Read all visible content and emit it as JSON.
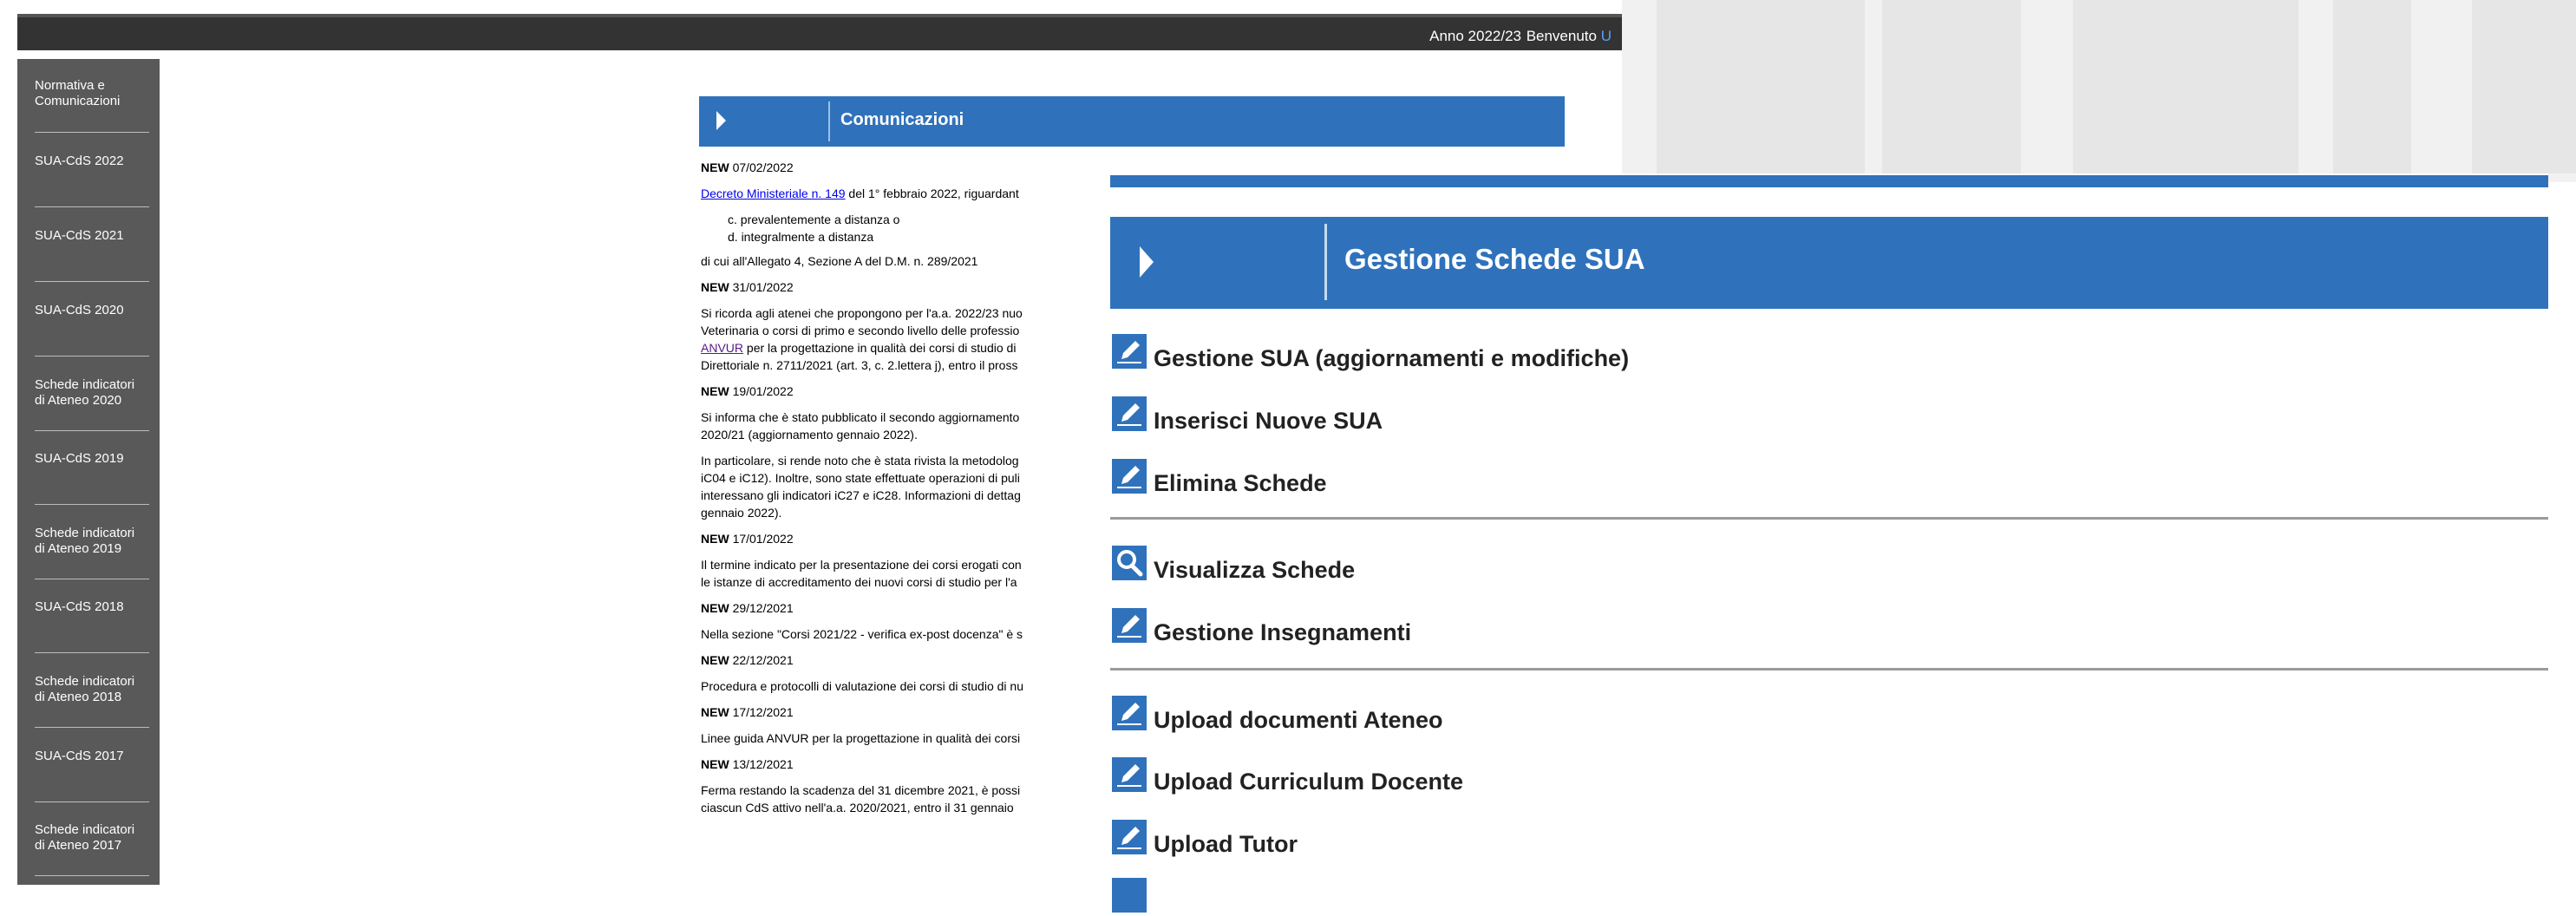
{
  "topbar": {
    "year": "Anno 2022/23",
    "welcome": "Benvenuto",
    "user": "U"
  },
  "sidebar": {
    "items": [
      {
        "line1": "Normativa e",
        "line2": "Comunicazioni"
      },
      {
        "line1": "SUA-CdS 2022",
        "line2": ""
      },
      {
        "line1": "SUA-CdS 2021",
        "line2": ""
      },
      {
        "line1": "SUA-CdS 2020",
        "line2": ""
      },
      {
        "line1": "Schede indicatori",
        "line2": "di Ateneo 2020"
      },
      {
        "line1": "SUA-CdS 2019",
        "line2": ""
      },
      {
        "line1": "Schede indicatori",
        "line2": "di Ateneo 2019"
      },
      {
        "line1": "SUA-CdS 2018",
        "line2": ""
      },
      {
        "line1": "Schede indicatori",
        "line2": "di Ateneo 2018"
      },
      {
        "line1": "SUA-CdS 2017",
        "line2": ""
      },
      {
        "line1": "Schede indicatori",
        "line2": "di Ateneo 2017"
      }
    ]
  },
  "comunicazioni": {
    "title": "Comunicazioni",
    "new_tag": "NEW",
    "n1_date": "07/02/2022",
    "n1_link": "Decreto Ministeriale n. 149",
    "n1_text": " del 1° febbraio 2022, riguardant",
    "n1_item_c": "c. prevalentemente a distanza o",
    "n1_item_d": "d. integralmente a distanza",
    "n1_tail": "di cui all'Allegato 4, Sezione A del D.M. n. 289/2021",
    "n2_date": "31/01/2022",
    "n2_l1": "Si ricorda agli atenei che propongono per l'a.a. 2022/23 nuo",
    "n2_l2": "Veterinaria o corsi di primo e secondo livello delle professio",
    "n2_link": "ANVUR",
    "n2_l3": " per la progettazione in qualità dei corsi di studio di",
    "n2_l4": "Direttoriale n. 2711/2021 (art. 3, c. 2.lettera j), entro il pross",
    "n3_date": "19/01/2022",
    "n3_l1": "Si informa che è stato pubblicato il secondo aggiornamento",
    "n3_l2": "2020/21 (aggiornamento gennaio 2022).",
    "n3_l3": "In particolare, si rende noto che è stata rivista la metodolog",
    "n3_l4": "iC04 e iC12). Inoltre, sono state effettuate operazioni di puli",
    "n3_l5": "interessano gli indicatori iC27 e iC28. Informazioni di dettag",
    "n3_l6": "gennaio 2022).",
    "n4_date": "17/01/2022",
    "n4_l1": "Il termine indicato per la presentazione dei corsi erogati con",
    "n4_l2": "le istanze di accreditamento dei nuovi corsi di studio per l'a",
    "n5_date": "29/12/2021",
    "n5_l1": "Nella sezione \"Corsi 2021/22 - verifica ex-post docenza\" è s",
    "n6_date": "22/12/2021",
    "n6_l1": "Procedura e protocolli di valutazione dei corsi di studio di nu",
    "n7_date": "17/12/2021",
    "n7_l1": "Linee guida ANVUR per la progettazione in qualità dei corsi",
    "n8_date": "13/12/2021",
    "n8_l1": "Ferma restando la scadenza del 31 dicembre 2021, è possi",
    "n8_l2": "ciascun CdS attivo nell'a.a. 2020/2021, entro il 31 gennaio"
  },
  "gestione": {
    "title": "Gestione Schede SUA",
    "items": [
      {
        "label": "Gestione SUA (aggiornamenti e modifiche)",
        "icon": "pencil-icon"
      },
      {
        "label": "Inserisci Nuove SUA",
        "icon": "pencil-icon"
      },
      {
        "label": "Elimina Schede",
        "icon": "pencil-icon"
      },
      {
        "label": "Visualizza Schede",
        "icon": "magnifier-icon"
      },
      {
        "label": "Gestione Insegnamenti",
        "icon": "pencil-icon"
      },
      {
        "label": "Upload documenti Ateneo",
        "icon": "pencil-icon"
      },
      {
        "label": "Upload Curriculum Docente",
        "icon": "pencil-icon"
      },
      {
        "label": "Upload Tutor",
        "icon": "pencil-icon"
      }
    ]
  },
  "colors": {
    "accent_blue": "#2f72bb",
    "sidebar_gray": "#595959",
    "topbar_dark": "#333333"
  }
}
